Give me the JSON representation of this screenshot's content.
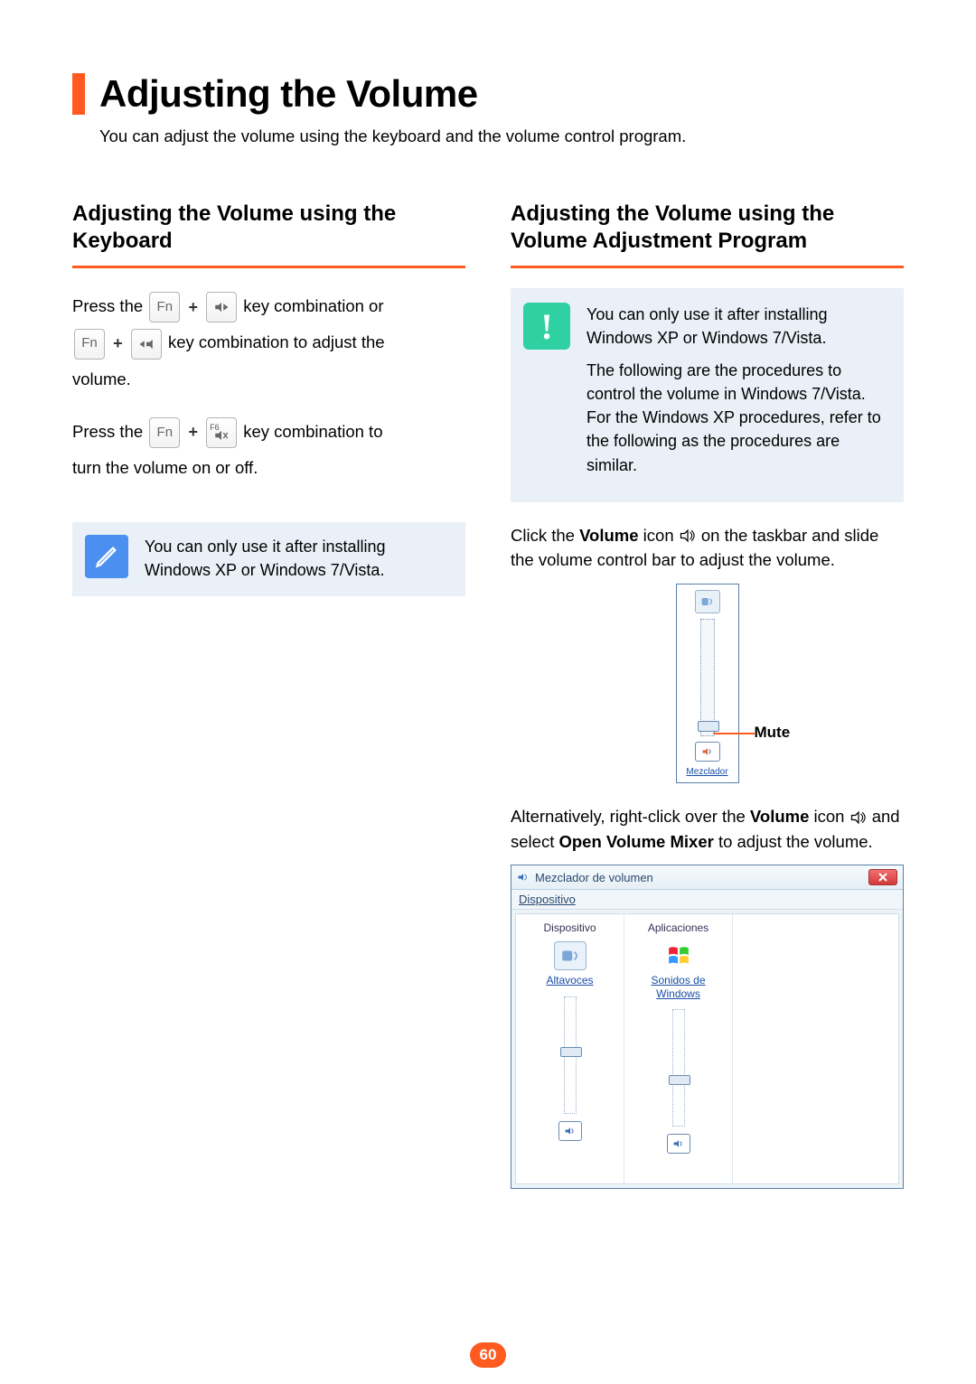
{
  "page": {
    "title": "Adjusting the Volume",
    "intro": "You can adjust the volume using the keyboard and the volume control program.",
    "page_number": "60"
  },
  "left": {
    "heading": "Adjusting the Volume using the Keyboard",
    "line1_a": "Press the ",
    "line1_b": " key combination or ",
    "line2_a": " key combination to adjust the ",
    "line2_b": "volume.",
    "line3_a": "Press the ",
    "line3_b": " key combination to ",
    "line3_c": "turn the volume on or off.",
    "note": "You can only use it after installing Windows XP or Windows 7/Vista."
  },
  "right": {
    "heading": "Adjusting the Volume using the Volume Adjustment Program",
    "alert_p1": "You can only use it after installing Windows XP or Windows 7/Vista.",
    "alert_p2": "The following are the procedures to control the volume in Windows 7/Vista. For the Windows XP procedures, refer to the following as the procedures are similar.",
    "para1_a": "Click the ",
    "para1_b": "Volume",
    "para1_c": " icon ",
    "para1_d": " on the taskbar and slide the volume control bar to adjust the volume.",
    "mute_label": "Mute",
    "mezclador_link": "Mezclador",
    "para2_a": "Alternatively, right-click over the ",
    "para2_b": "Volume",
    "para2_c": " icon ",
    "para2_d": " and select ",
    "para2_e": "Open Volume Mixer",
    "para2_f": " to adjust the volume.",
    "mixer": {
      "title": "Mezclador de volumen",
      "menu": "Dispositivo",
      "col1_hdr": "Dispositivo",
      "col1_lbl": "Altavoces",
      "col2_hdr": "Aplicaciones",
      "col2_lbl": "Sonidos de Windows"
    }
  },
  "keys": {
    "fn": "Fn",
    "f6": "F6",
    "plus": "+"
  },
  "alert_glyph": "!"
}
